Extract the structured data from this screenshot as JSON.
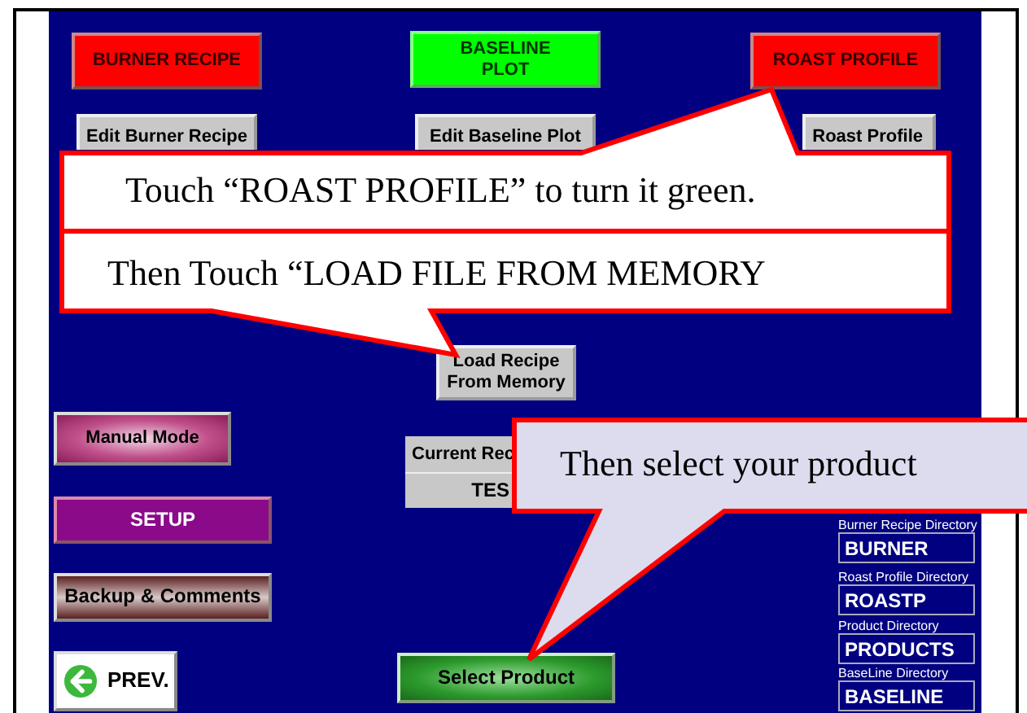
{
  "mode_buttons": [
    {
      "label": "BURNER RECIPE",
      "on": false
    },
    {
      "label": "BASELINE PLOT",
      "on": true
    },
    {
      "label": "ROAST PROFILE",
      "on": false
    }
  ],
  "edit_buttons": [
    "Edit Burner Recipe",
    "Edit Baseline Plot",
    "Roast Profile"
  ],
  "load_button": "Load Recipe From Memory",
  "manual_mode_button": "Manual Mode",
  "current_recipe": {
    "label": "Current Rec",
    "value": "TES"
  },
  "setup_button": "SETUP",
  "backup_button": "Backup & Comments",
  "prev_button": "PREV.",
  "select_product_button": "Select Product",
  "directory": {
    "entries": [
      {
        "label": "Burner Recipe Directory",
        "value": "BURNER"
      },
      {
        "label": "Roast Profile Directory",
        "value": "ROASTP"
      },
      {
        "label": "Product  Directory",
        "value": "PRODUCTS"
      },
      {
        "label": "BaseLine Directory",
        "value": "BASELINE"
      }
    ]
  },
  "callouts": [
    {
      "text": "Touch “ROAST PROFILE” to turn it green."
    },
    {
      "text": "Then Touch “LOAD FILE FROM MEMORY"
    },
    {
      "text": "Then select your product"
    }
  ]
}
